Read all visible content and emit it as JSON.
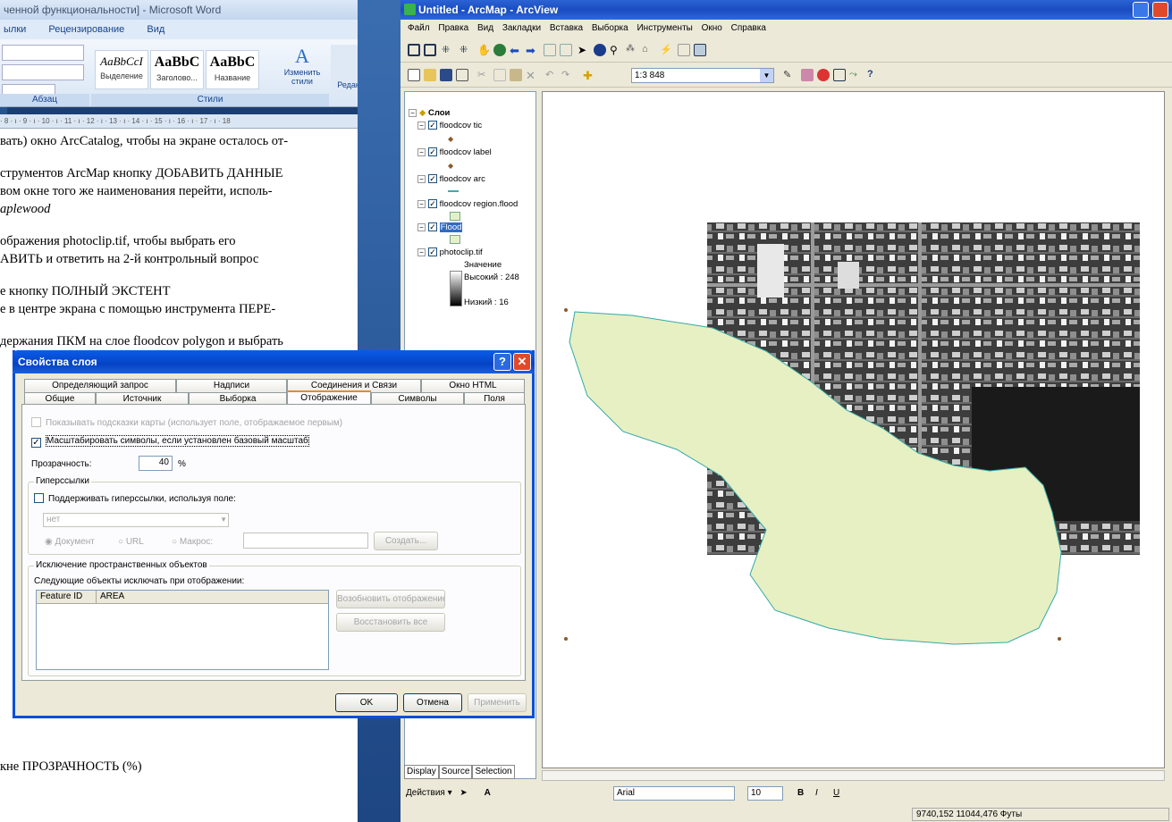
{
  "word": {
    "title": "ченной функциональности] - Microsoft Word",
    "tabs": [
      "ылки",
      "Рецензирование",
      "Вид"
    ],
    "styles": [
      {
        "sample": "AaBbCcI",
        "name": "Выделение"
      },
      {
        "sample": "AaBbC",
        "name": "Заголово..."
      },
      {
        "sample": "AaBbC",
        "name": "Название"
      }
    ],
    "change_styles": "Изменить стили",
    "editing": "Редактировани",
    "group_paragraph": "Абзац",
    "group_styles": "Стили",
    "ruler": "· 8 · ı · 9 · ı · 10 · ı · 11 · ı · 12 · ı · 13 · ı · 14 · ı · 15 · ı · 16 · ı · 17 · ı · 18",
    "lines": [
      "вать) окно ArcCatalog, чтобы на экране осталось от-",
      "струментов ArcMap кнопку ДОБАВИТЬ ДАННЫЕ",
      "вом окне того же наименования перейти, исполь-",
      "aplewood",
      "ображения photoclip.tif, чтобы выбрать его",
      "АВИТЬ и ответить на 2-й контрольный вопрос",
      "е кнопку ПОЛНЫЙ ЭКСТЕНТ",
      "е в центре экрана с помощью инструмента ПЕРЕ-",
      "держания ПКМ на слое floodcov polygon и выбрать",
      "кне ПРОЗРАЧНОСТЬ (%)"
    ]
  },
  "arcmap": {
    "title": "Untitled - ArcMap - ArcView",
    "menu": [
      "Файл",
      "Правка",
      "Вид",
      "Закладки",
      "Вставка",
      "Выборка",
      "Инструменты",
      "Окно",
      "Справка"
    ],
    "scale": "1:3 848",
    "toc": {
      "root": "Слои",
      "layers": [
        "floodcov tic",
        "floodcov label",
        "floodcov arc",
        "floodcov region.flood",
        "Flood",
        "photoclip.tif"
      ],
      "legend_title": "Значение",
      "high": "Высокий : 248",
      "low": "Низкий : 16",
      "tabs": [
        "Display",
        "Source",
        "Selection"
      ]
    },
    "drawing_label": "Действия ▾",
    "font": "Arial",
    "font_size": "10",
    "coords": "9740,152  11044,476 Футы"
  },
  "dialog": {
    "title": "Свойства слоя",
    "tabs_row1": [
      "Определяющий запрос",
      "Надписи",
      "Соединения и Связи",
      "Окно HTML"
    ],
    "tabs_row2": [
      "Общие",
      "Источник",
      "Выборка",
      "Отображение",
      "Символы",
      "Поля"
    ],
    "show_tips": "Показывать подсказки карты (использует поле, отображаемое первым)",
    "scale_symbols": "Масштабировать символы, если установлен базовый масштаб",
    "transparency_label": "Прозрачность:",
    "transparency_value": "40",
    "percent": "%",
    "hyperlinks_legend": "Гиперссылки",
    "support_hyperlinks": "Поддерживать гиперссылки, используя поле:",
    "field_value": "нет",
    "radio_document": "Документ",
    "radio_url": "URL",
    "radio_macro": "Макрос:",
    "create_btn": "Создать...",
    "exclusion_legend": "Исключение пространственных объектов",
    "exclusion_text": "Следующие объекты исключать при отображении:",
    "col_feature_id": "Feature ID",
    "col_area": "AREA",
    "resume_btn": "Возобновить отображение",
    "restore_btn": "Восстановить все",
    "ok": "OK",
    "cancel": "Отмена",
    "apply": "Применить"
  }
}
